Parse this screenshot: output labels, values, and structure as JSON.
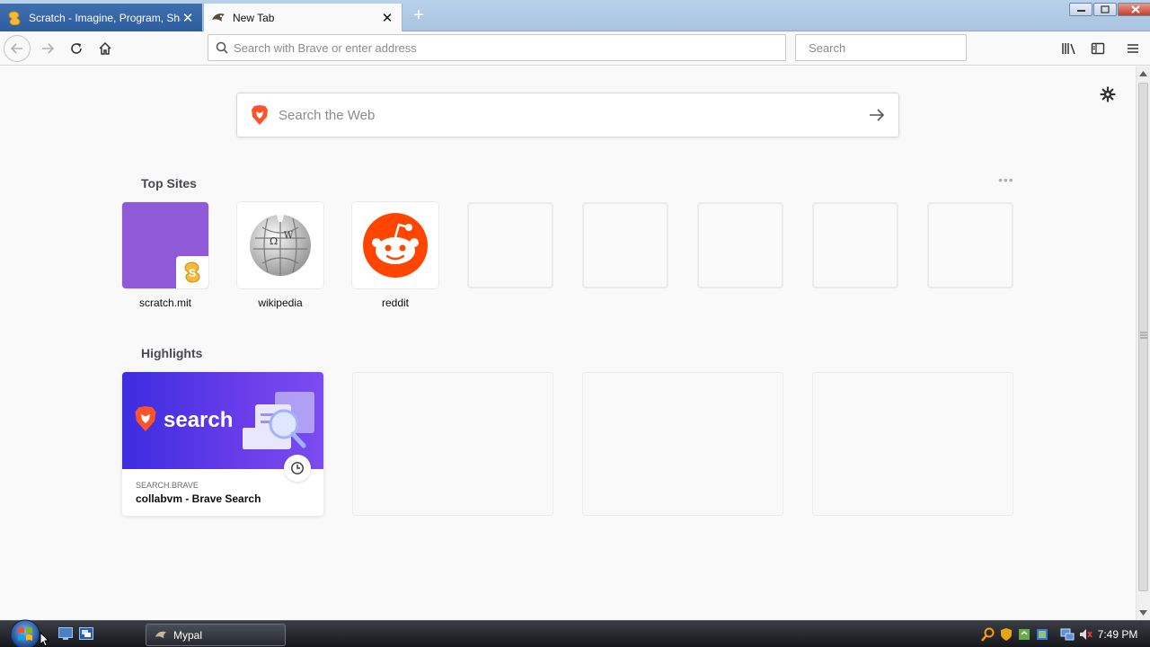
{
  "tabs": [
    {
      "label": "Scratch - Imagine, Program, Share",
      "icon": "scratch-icon",
      "active": false
    },
    {
      "label": "New Tab",
      "icon": "mypal-icon",
      "active": true
    }
  ],
  "navbar": {
    "url_placeholder": "Search with Brave or enter address",
    "search_placeholder": "Search"
  },
  "newtab": {
    "web_search_placeholder": "Search the Web",
    "top_sites_title": "Top Sites",
    "top_sites": [
      {
        "label": "scratch.mit",
        "icon": "scratch-icon"
      },
      {
        "label": "wikipedia",
        "icon": "wikipedia-globe-icon"
      },
      {
        "label": "reddit",
        "icon": "reddit-icon"
      }
    ],
    "highlights_title": "Highlights",
    "highlights": [
      {
        "brand_word": "search",
        "host": "SEARCH.BRAVE",
        "title": "collabvm - Brave Search"
      }
    ]
  },
  "taskbar": {
    "task_label": "Mypal",
    "clock": "7:49 PM"
  },
  "colors": {
    "scratch_tile": "#8f59d8",
    "reddit": "#ff4500",
    "brave": "#fb542b",
    "brave_search_bg": "#3b2de0"
  }
}
